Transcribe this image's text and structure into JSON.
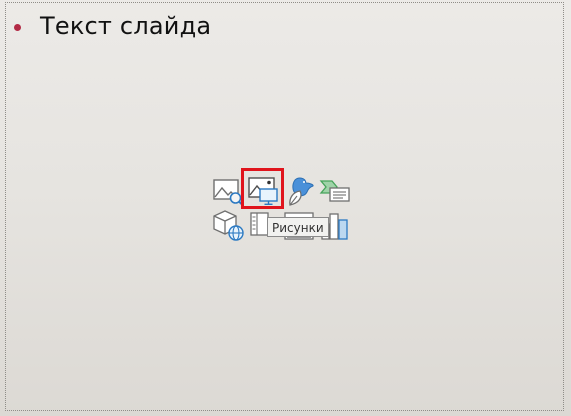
{
  "slide": {
    "body_text": "Текст слайда",
    "bullet_color": "#b22a45"
  },
  "content_placeholder": {
    "tooltip": "Рисунки",
    "icons": [
      {
        "name": "stock-images-icon"
      },
      {
        "name": "pictures-icon",
        "highlighted": true
      },
      {
        "name": "icons-icon"
      },
      {
        "name": "smartart-icon"
      },
      {
        "name": "3d-models-icon"
      },
      {
        "name": "table-icon"
      },
      {
        "name": "video-icon"
      },
      {
        "name": "chart-icon"
      }
    ],
    "highlight_color": "#e0141c"
  }
}
